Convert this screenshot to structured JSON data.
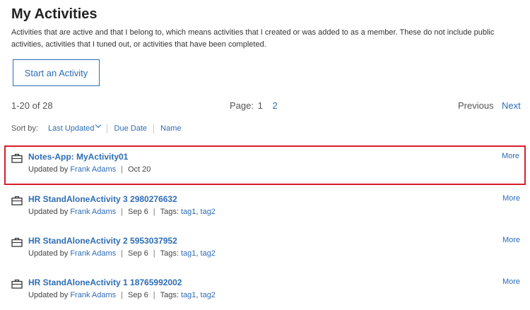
{
  "page": {
    "title": "My Activities",
    "description": "Activities that are active and that I belong to, which means activities that I created or was added to as a member. These do not include public activities, activities that I tuned out, or activities that have been completed."
  },
  "actions": {
    "start_activity": "Start an Activity"
  },
  "paging": {
    "count": "1-20 of 28",
    "page_label": "Page:",
    "pages": [
      "1",
      "2"
    ],
    "previous": "Previous",
    "next": "Next"
  },
  "sort": {
    "label": "Sort by:",
    "options": [
      "Last Updated",
      "Due Date",
      "Name"
    ]
  },
  "activities": [
    {
      "name": "Notes-App: MyActivity01",
      "updated_by_label": "Updated by",
      "user": "Frank Adams",
      "date": "Oct 20",
      "tags_label": "",
      "tags": [],
      "more": "More"
    },
    {
      "name": "HR StandAloneActivity 3 2980276632",
      "updated_by_label": "Updated by",
      "user": "Frank Adams",
      "date": "Sep 6",
      "tags_label": "Tags:",
      "tags": [
        "tag1",
        "tag2"
      ],
      "more": "More"
    },
    {
      "name": "HR StandAloneActivity 2 5953037952",
      "updated_by_label": "Updated by",
      "user": "Frank Adams",
      "date": "Sep 6",
      "tags_label": "Tags:",
      "tags": [
        "tag1",
        "tag2"
      ],
      "more": "More"
    },
    {
      "name": "HR StandAloneActivity 1 18765992002",
      "updated_by_label": "Updated by",
      "user": "Frank Adams",
      "date": "Sep 6",
      "tags_label": "Tags:",
      "tags": [
        "tag1",
        "tag2"
      ],
      "more": "More"
    }
  ],
  "colors": {
    "link": "#2d6db5",
    "highlight_border": "#d71f2a"
  },
  "icons": {
    "activity": "briefcase-icon"
  }
}
